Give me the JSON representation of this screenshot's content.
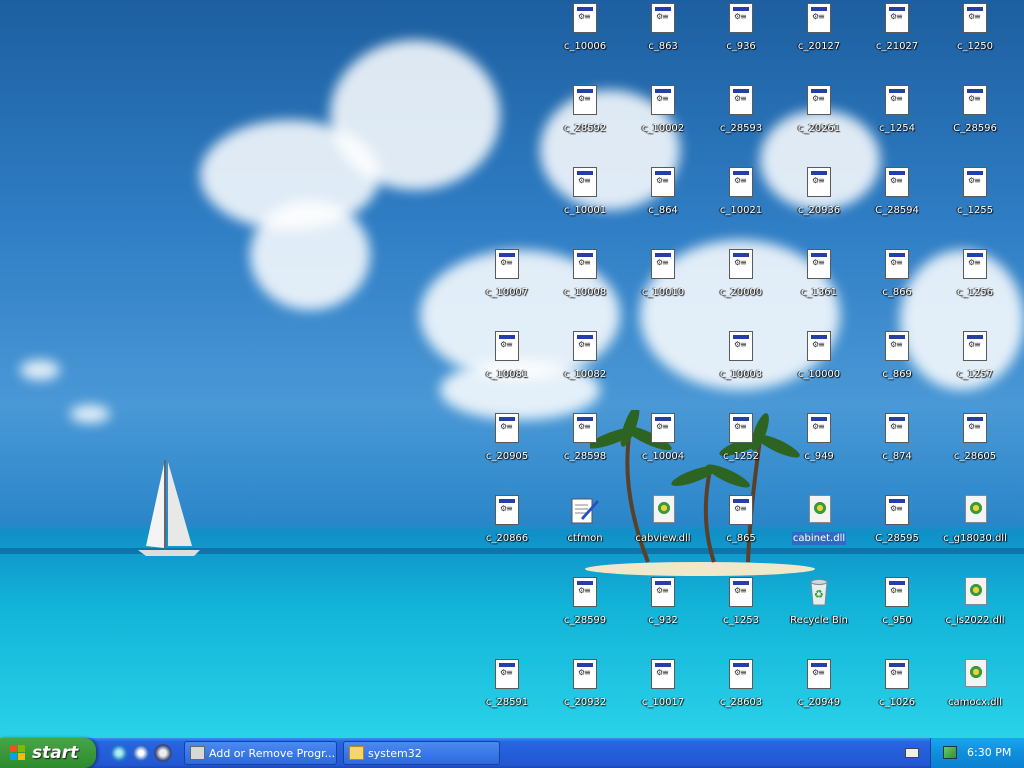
{
  "desktop_icons": [
    {
      "label": "c_10006",
      "type": "doc"
    },
    {
      "label": "c_863",
      "type": "doc"
    },
    {
      "label": "c_936",
      "type": "doc"
    },
    {
      "label": "c_20127",
      "type": "doc"
    },
    {
      "label": "c_21027",
      "type": "doc"
    },
    {
      "label": "c_1250",
      "type": "doc"
    },
    {
      "label": "c_28592",
      "type": "doc"
    },
    {
      "label": "c_10002",
      "type": "doc"
    },
    {
      "label": "c_28593",
      "type": "doc"
    },
    {
      "label": "c_20261",
      "type": "doc"
    },
    {
      "label": "c_1254",
      "type": "doc"
    },
    {
      "label": "C_28596",
      "type": "doc"
    },
    {
      "label": "c_10001",
      "type": "doc"
    },
    {
      "label": "c_864",
      "type": "doc"
    },
    {
      "label": "c_10021",
      "type": "doc"
    },
    {
      "label": "c_20936",
      "type": "doc"
    },
    {
      "label": "C_28594",
      "type": "doc"
    },
    {
      "label": "c_1255",
      "type": "doc"
    },
    {
      "label": "c_10007",
      "type": "doc"
    },
    {
      "label": "c_10008",
      "type": "doc"
    },
    {
      "label": "c_10010",
      "type": "doc"
    },
    {
      "label": "c_20000",
      "type": "doc"
    },
    {
      "label": "c_1361",
      "type": "doc"
    },
    {
      "label": "c_866",
      "type": "doc"
    },
    {
      "label": "c_1256",
      "type": "doc"
    },
    {
      "label": "c_10081",
      "type": "doc"
    },
    {
      "label": "c_10082",
      "type": "doc"
    },
    {
      "label": "c_10003",
      "type": "doc"
    },
    {
      "label": "c_10000",
      "type": "doc"
    },
    {
      "label": "c_869",
      "type": "doc"
    },
    {
      "label": "c_1257",
      "type": "doc"
    },
    {
      "label": "c_20905",
      "type": "doc"
    },
    {
      "label": "c_28598",
      "type": "doc"
    },
    {
      "label": "c_10004",
      "type": "doc"
    },
    {
      "label": "c_1252",
      "type": "doc"
    },
    {
      "label": "c_949",
      "type": "doc"
    },
    {
      "label": "c_874",
      "type": "doc"
    },
    {
      "label": "c_28605",
      "type": "doc"
    },
    {
      "label": "c_20866",
      "type": "doc"
    },
    {
      "label": "ctfmon",
      "type": "ctfmon"
    },
    {
      "label": "cabview.dll",
      "type": "dll"
    },
    {
      "label": "c_865",
      "type": "doc"
    },
    {
      "label": "cabinet.dll",
      "type": "dll",
      "selected": true
    },
    {
      "label": "C_28595",
      "type": "doc"
    },
    {
      "label": "c_g18030.dll",
      "type": "dll"
    },
    {
      "label": "c_28599",
      "type": "doc"
    },
    {
      "label": "c_932",
      "type": "doc"
    },
    {
      "label": "c_1253",
      "type": "doc"
    },
    {
      "label": "Recycle Bin",
      "type": "recycle"
    },
    {
      "label": "c_950",
      "type": "doc"
    },
    {
      "label": "c_is2022.dll",
      "type": "dll"
    },
    {
      "label": "c_28591",
      "type": "doc"
    },
    {
      "label": "c_20932",
      "type": "doc"
    },
    {
      "label": "c_10017",
      "type": "doc"
    },
    {
      "label": "c_28603",
      "type": "doc"
    },
    {
      "label": "c_20949",
      "type": "doc"
    },
    {
      "label": "c_1026",
      "type": "doc"
    },
    {
      "label": "camocx.dll",
      "type": "dll"
    }
  ],
  "taskbar": {
    "start_label": "start",
    "quick_launch": [
      "ie-icon",
      "outlook-express-icon",
      "media-player-icon"
    ],
    "tasks": [
      {
        "label": "Add or Remove Progr...",
        "icon": "control-panel-icon"
      },
      {
        "label": "system32",
        "icon": "folder-icon"
      }
    ],
    "clock": "6:30 PM",
    "tray_icons": [
      "keyboard-icon",
      "network-icon"
    ]
  },
  "colors": {
    "taskbar": "#245edb",
    "start": "#3c9a3c",
    "tray": "#0f8fdc",
    "selection": "#316ac5"
  }
}
